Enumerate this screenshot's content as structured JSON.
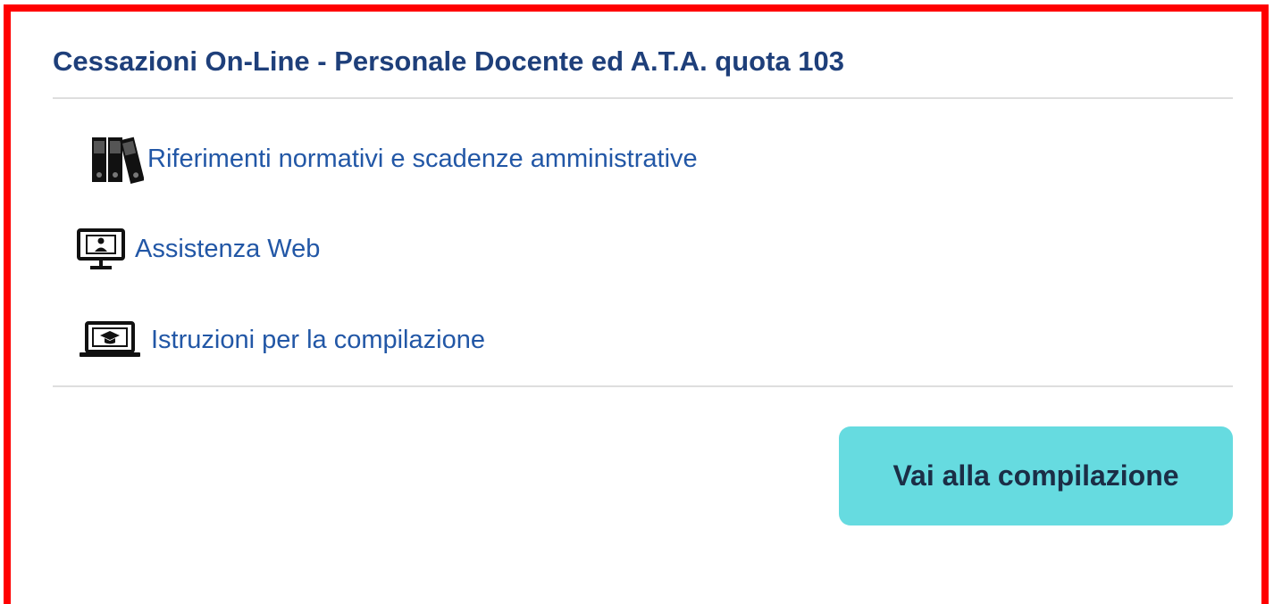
{
  "card": {
    "title": "Cessazioni On-Line - Personale Docente ed A.T.A. quota 103",
    "border_color": "#ff0000"
  },
  "links": [
    {
      "label": "Riferimenti normativi e scadenze amministrative",
      "icon": "binders-icon"
    },
    {
      "label": "Assistenza Web",
      "icon": "monitor-support-icon"
    },
    {
      "label": "Istruzioni per la compilazione",
      "icon": "laptop-graduation-icon"
    }
  ],
  "action": {
    "label": "Vai alla compilazione",
    "color": "#66dbe0"
  },
  "colors": {
    "title": "#1e3f7a",
    "link": "#2257a6"
  }
}
